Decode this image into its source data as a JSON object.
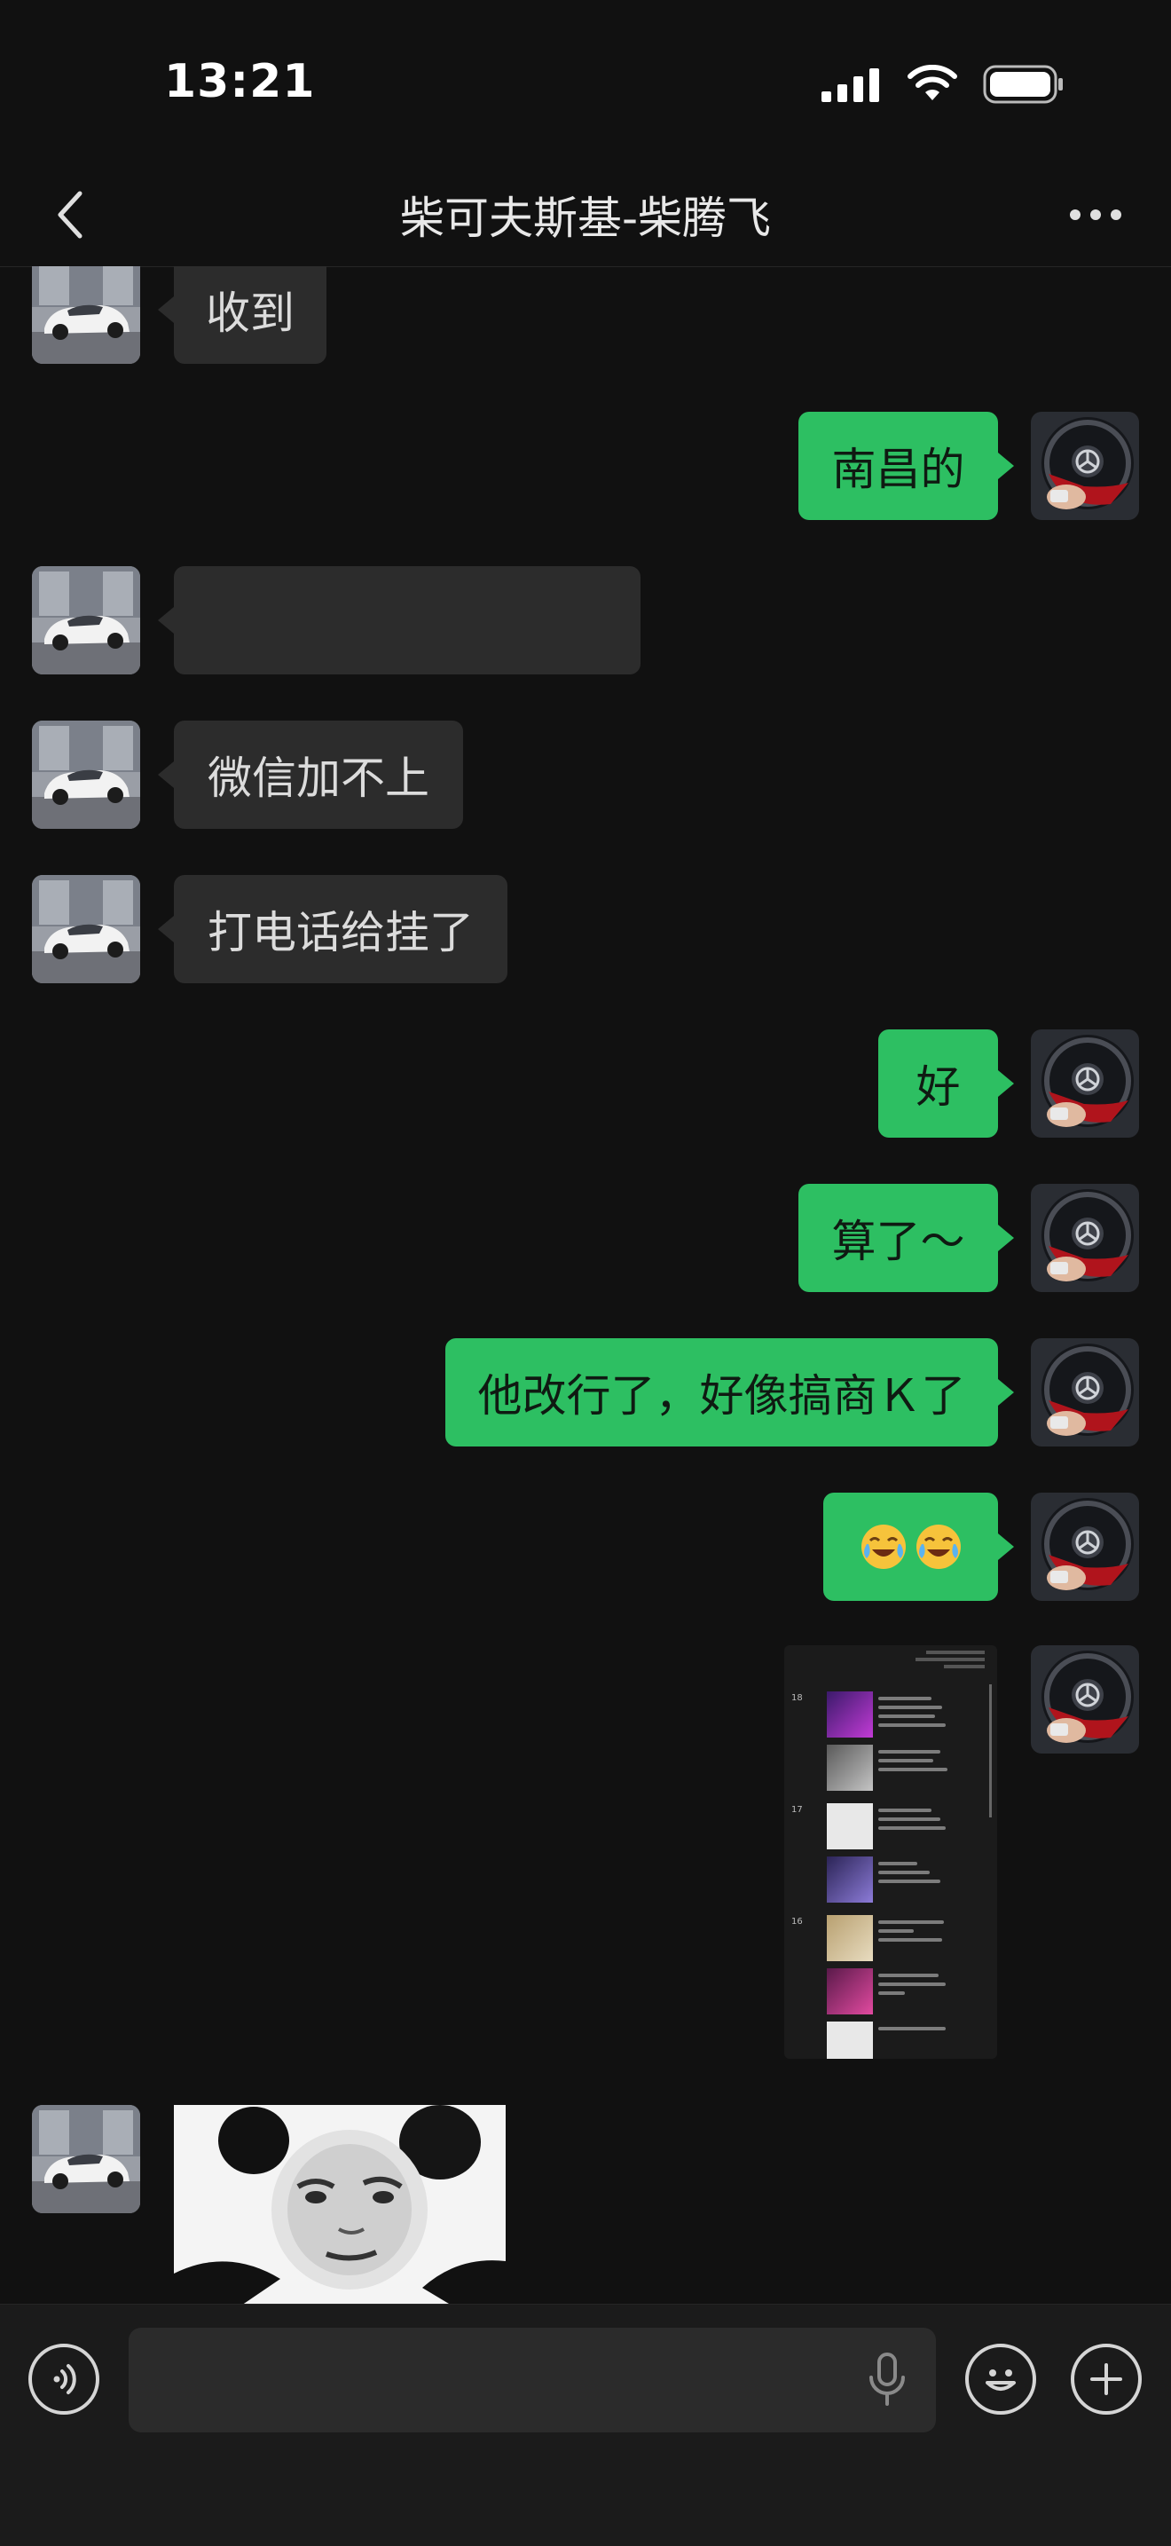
{
  "status_bar": {
    "time": "13:21"
  },
  "nav": {
    "title": "柴可夫斯基-柴腾飞"
  },
  "messages": [
    {
      "side": "left",
      "text": "收到"
    },
    {
      "side": "right",
      "text": "南昌的"
    },
    {
      "side": "left",
      "text": ""
    },
    {
      "side": "left",
      "text": "微信加不上"
    },
    {
      "side": "left",
      "text": "打电话给挂了"
    },
    {
      "side": "right",
      "text": "好"
    },
    {
      "side": "right",
      "text": "算了～"
    },
    {
      "side": "right",
      "text": "他改行了，好像搞商Ｋ了"
    },
    {
      "side": "right",
      "emoji": [
        "face-tears-of-joy",
        "face-tears-of-joy"
      ]
    },
    {
      "side": "right",
      "image": "moments-screenshot"
    },
    {
      "side": "left",
      "image": "panda-meme-sticker"
    }
  ],
  "screenshot_dates": [
    "18",
    "17",
    "16"
  ],
  "colors": {
    "background": "#111111",
    "bubble_self": "#2dbf62",
    "bubble_other": "#2c2c2c"
  }
}
